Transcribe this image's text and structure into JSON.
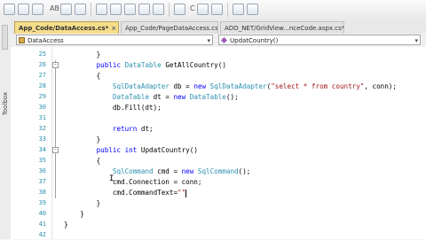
{
  "toolbar": {
    "label_abc": "AB",
    "label_c": "C"
  },
  "toolbox": {
    "label": "Toolbox"
  },
  "tabs": [
    {
      "label": "App_Code/DataAccess.cs*"
    },
    {
      "label": "App_Code/PageDataAccess.cs"
    },
    {
      "label": "ADO_NET/GridView...nceCode.aspx.cs*"
    }
  ],
  "tab_close": "×",
  "navbar": {
    "class_combo": "DataAccess",
    "member_combo": "UpdatCountry()"
  },
  "editor": {
    "lines": [
      {
        "num": "25",
        "fold": "",
        "segments": [
          {
            "t": "        }",
            "c": ""
          }
        ]
      },
      {
        "num": "26",
        "fold": "-",
        "segments": [
          {
            "t": "        ",
            "c": ""
          },
          {
            "t": "public",
            "c": "kw"
          },
          {
            "t": " ",
            "c": ""
          },
          {
            "t": "DataTable",
            "c": "tp"
          },
          {
            "t": " GetAllCountry()",
            "c": ""
          }
        ]
      },
      {
        "num": "27",
        "fold": "",
        "segments": [
          {
            "t": "        {",
            "c": ""
          }
        ]
      },
      {
        "num": "28",
        "fold": "",
        "segments": [
          {
            "t": "            ",
            "c": ""
          },
          {
            "t": "SqlDataAdapter",
            "c": "tp"
          },
          {
            "t": " db = ",
            "c": ""
          },
          {
            "t": "new",
            "c": "kw"
          },
          {
            "t": " ",
            "c": ""
          },
          {
            "t": "SqlDataAdapter",
            "c": "tp"
          },
          {
            "t": "(",
            "c": ""
          },
          {
            "t": "\"select * from country\"",
            "c": "st"
          },
          {
            "t": ", conn);",
            "c": ""
          }
        ]
      },
      {
        "num": "29",
        "fold": "",
        "segments": [
          {
            "t": "            ",
            "c": ""
          },
          {
            "t": "DataTable",
            "c": "tp"
          },
          {
            "t": " dt = ",
            "c": ""
          },
          {
            "t": "new",
            "c": "kw"
          },
          {
            "t": " ",
            "c": ""
          },
          {
            "t": "DataTable",
            "c": "tp"
          },
          {
            "t": "();",
            "c": ""
          }
        ]
      },
      {
        "num": "30",
        "fold": "",
        "segments": [
          {
            "t": "            db.Fill(dt);",
            "c": ""
          }
        ]
      },
      {
        "num": "31",
        "fold": "",
        "segments": [
          {
            "t": "",
            "c": ""
          }
        ]
      },
      {
        "num": "32",
        "fold": "",
        "segments": [
          {
            "t": "            ",
            "c": ""
          },
          {
            "t": "return",
            "c": "kw"
          },
          {
            "t": " dt;",
            "c": ""
          }
        ]
      },
      {
        "num": "33",
        "fold": "",
        "segments": [
          {
            "t": "        }",
            "c": ""
          }
        ]
      },
      {
        "num": "34",
        "fold": "-",
        "segments": [
          {
            "t": "        ",
            "c": ""
          },
          {
            "t": "public",
            "c": "kw"
          },
          {
            "t": " ",
            "c": ""
          },
          {
            "t": "int",
            "c": "kw"
          },
          {
            "t": " UpdatCountry()",
            "c": ""
          }
        ]
      },
      {
        "num": "35",
        "fold": "",
        "segments": [
          {
            "t": "        {",
            "c": ""
          }
        ]
      },
      {
        "num": "36",
        "fold": "",
        "segments": [
          {
            "t": "            ",
            "c": ""
          },
          {
            "t": "SqlCommand",
            "c": "tp"
          },
          {
            "t": " cmd = ",
            "c": ""
          },
          {
            "t": "new",
            "c": "kw"
          },
          {
            "t": " ",
            "c": ""
          },
          {
            "t": "SqlCommand",
            "c": "tp"
          },
          {
            "t": "();",
            "c": ""
          }
        ]
      },
      {
        "num": "37",
        "fold": "",
        "segments": [
          {
            "t": "            cmd.Connection = conn;",
            "c": ""
          }
        ]
      },
      {
        "num": "38",
        "fold": "",
        "segments": [
          {
            "t": "            cmd.CommandText=",
            "c": ""
          },
          {
            "t": "\"\"",
            "c": "st"
          }
        ]
      },
      {
        "num": "39",
        "fold": "",
        "segments": [
          {
            "t": "        }",
            "c": ""
          }
        ]
      },
      {
        "num": "40",
        "fold": "",
        "segments": [
          {
            "t": "    }",
            "c": ""
          }
        ]
      },
      {
        "num": "41",
        "fold": "",
        "segments": [
          {
            "t": "}",
            "c": ""
          }
        ]
      },
      {
        "num": "42",
        "fold": "",
        "segments": [
          {
            "t": "",
            "c": ""
          }
        ]
      }
    ]
  }
}
